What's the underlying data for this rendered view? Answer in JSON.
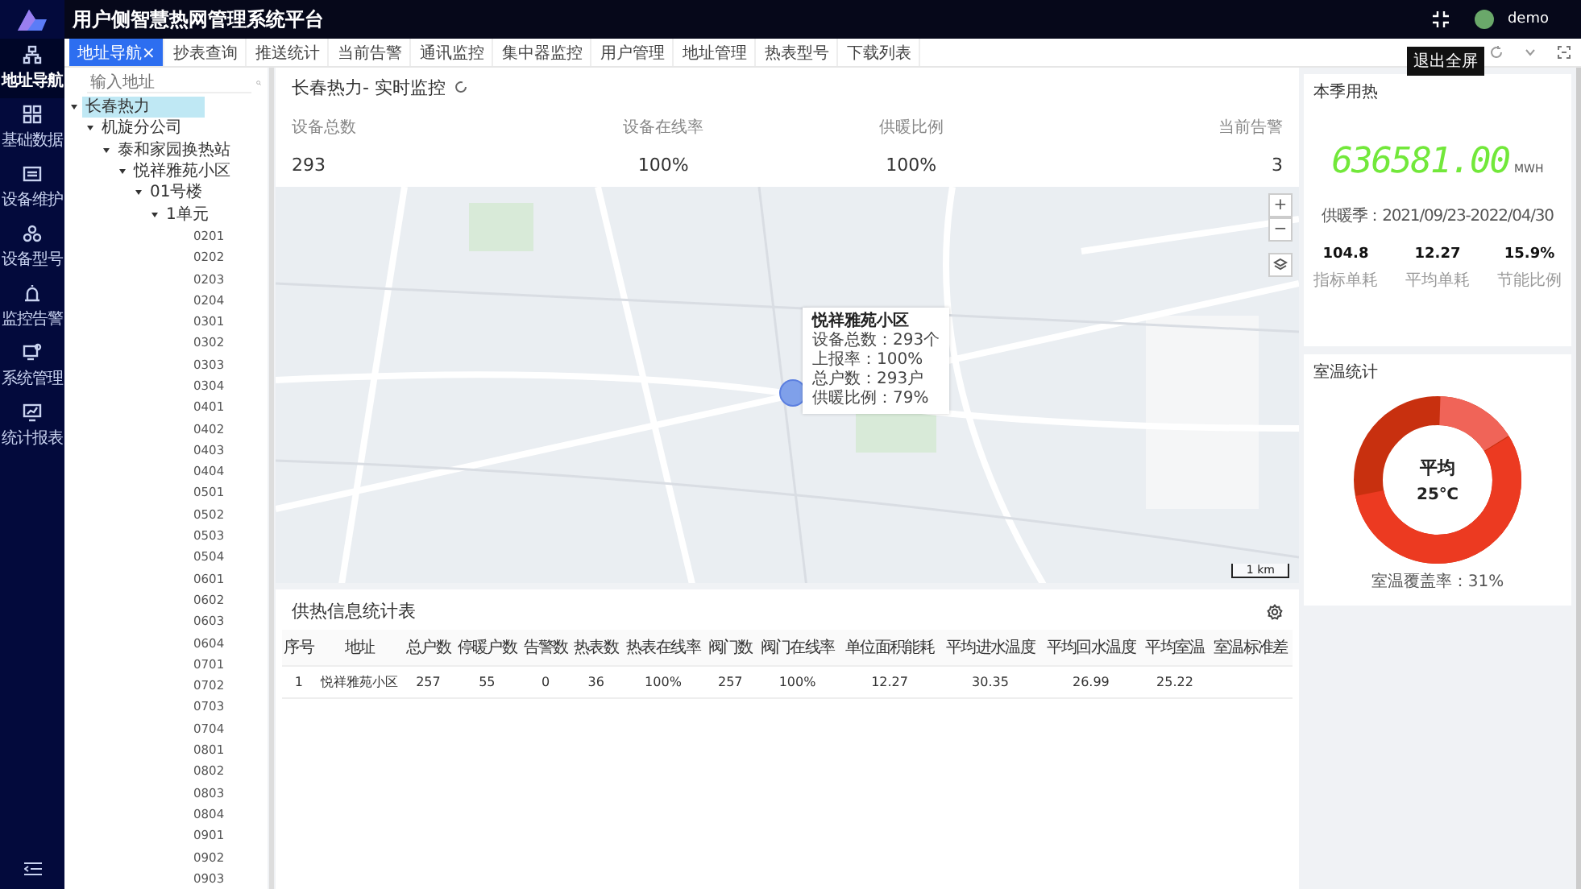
{
  "app": {
    "title": "用户侧智慧热网管理系统平台",
    "user": "demo",
    "tooltip": "退出全屏"
  },
  "nav": [
    {
      "label": "地址导航",
      "selected": true
    },
    {
      "label": "基础数据",
      "selected": false
    },
    {
      "label": "设备维护",
      "selected": false
    },
    {
      "label": "设备型号",
      "selected": false
    },
    {
      "label": "监控告警",
      "selected": false
    },
    {
      "label": "系统管理",
      "selected": false
    },
    {
      "label": "统计报表",
      "selected": false
    }
  ],
  "tabs": [
    {
      "label": "地址导航",
      "close": "×",
      "selected": true
    },
    {
      "label": "抄表查询",
      "selected": false
    },
    {
      "label": "推送统计",
      "selected": false
    },
    {
      "label": "当前告警",
      "selected": false
    },
    {
      "label": "通讯监控",
      "selected": false
    },
    {
      "label": "集中器监控",
      "selected": false
    },
    {
      "label": "用户管理",
      "selected": false
    },
    {
      "label": "地址管理",
      "selected": false
    },
    {
      "label": "热表型号",
      "selected": false
    },
    {
      "label": "下载列表",
      "selected": false
    }
  ],
  "tree": {
    "placeholder": "输入地址",
    "nodes": [
      {
        "label": "长春热力",
        "selected": true,
        "expanded": true,
        "children": [
          {
            "label": "机旋分公司",
            "selected": false,
            "expanded": true,
            "children": [
              {
                "label": "泰和家园换热站",
                "selected": false,
                "expanded": true,
                "children": [
                  {
                    "label": "悦祥雅苑小区",
                    "selected": false,
                    "expanded": true,
                    "children": [
                      {
                        "label": "01号楼",
                        "selected": false,
                        "expanded": true,
                        "children": [
                          {
                            "label": "1单元",
                            "selected": false,
                            "expanded": true,
                            "children": [
                              {
                                "label": "0201",
                                "selected": false
                              },
                              {
                                "label": "0202",
                                "selected": false
                              },
                              {
                                "label": "0203",
                                "selected": false
                              },
                              {
                                "label": "0204",
                                "selected": false
                              },
                              {
                                "label": "0301",
                                "selected": false
                              },
                              {
                                "label": "0302",
                                "selected": false
                              },
                              {
                                "label": "0303",
                                "selected": false
                              },
                              {
                                "label": "0304",
                                "selected": false
                              },
                              {
                                "label": "0401",
                                "selected": false
                              },
                              {
                                "label": "0402",
                                "selected": false
                              },
                              {
                                "label": "0403",
                                "selected": false
                              },
                              {
                                "label": "0404",
                                "selected": false
                              },
                              {
                                "label": "0501",
                                "selected": false
                              },
                              {
                                "label": "0502",
                                "selected": false
                              },
                              {
                                "label": "0503",
                                "selected": false
                              },
                              {
                                "label": "0504",
                                "selected": false
                              },
                              {
                                "label": "0601",
                                "selected": false
                              },
                              {
                                "label": "0602",
                                "selected": false
                              },
                              {
                                "label": "0603",
                                "selected": false
                              },
                              {
                                "label": "0604",
                                "selected": false
                              },
                              {
                                "label": "0701",
                                "selected": false
                              },
                              {
                                "label": "0702",
                                "selected": false
                              },
                              {
                                "label": "0703",
                                "selected": false
                              },
                              {
                                "label": "0704",
                                "selected": false
                              },
                              {
                                "label": "0801",
                                "selected": false
                              },
                              {
                                "label": "0802",
                                "selected": false
                              },
                              {
                                "label": "0803",
                                "selected": false
                              },
                              {
                                "label": "0804",
                                "selected": false
                              },
                              {
                                "label": "0901",
                                "selected": false
                              },
                              {
                                "label": "0902",
                                "selected": false
                              },
                              {
                                "label": "0903",
                                "selected": false
                              }
                            ]
                          }
                        ]
                      }
                    ]
                  }
                ]
              }
            ]
          }
        ]
      }
    ]
  },
  "monitor": {
    "title": "长春热力- 实时监控",
    "stats": [
      {
        "label": "设备总数",
        "value": "293"
      },
      {
        "label": "设备在线率",
        "value": "100%"
      },
      {
        "label": "供暖比例",
        "value": "100%"
      },
      {
        "label": "当前告警",
        "value": "3"
      }
    ],
    "map": {
      "zoom_in": "+",
      "zoom_out": "−",
      "scale": "1 km",
      "tooltip": {
        "title": "悦祥雅苑小区",
        "lines": [
          "设备总数：293个",
          "上报率：100%",
          "总户数：293户",
          "供暖比例：79%"
        ]
      }
    }
  },
  "table": {
    "title": "供热信息统计表",
    "columns": [
      "序号",
      "地址",
      "总户数",
      "停暖户数",
      "告警数",
      "热表数",
      "热表在线率",
      "阀门数",
      "阀门在线率",
      "单位面积能耗",
      "平均进水温度",
      "平均回水温度",
      "平均室温",
      "室温标准差"
    ],
    "rows": [
      [
        "1",
        "悦祥雅苑小区",
        "257",
        "55",
        "0",
        "36",
        "100%",
        "257",
        "100%",
        "12.27",
        "30.35",
        "26.99",
        "25.22"
      ]
    ]
  },
  "season": {
    "title": "本季用热",
    "value": "636581.00",
    "unit": "MWH",
    "period": "供暖季：2021/09/23-2022/04/30",
    "stats": [
      {
        "value": "104.8",
        "label": "指标单耗"
      },
      {
        "value": "12.27",
        "label": "平均单耗"
      },
      {
        "value": "15.9%",
        "label": "节能比例"
      }
    ]
  },
  "room": {
    "title": "室温统计",
    "center_label": "平均",
    "center_value": "25℃",
    "coverage": "室温覆盖率：31%"
  }
}
